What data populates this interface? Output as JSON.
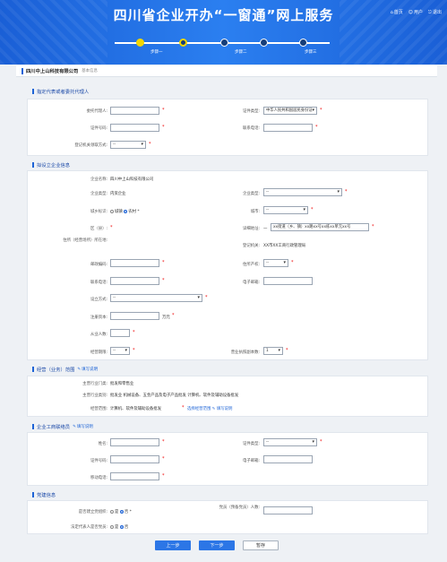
{
  "header": {
    "title": "四川省企业开办“一窗通”网上服务",
    "nav": [
      "首页",
      "用户",
      "退出"
    ],
    "steps": [
      "步骤一",
      "步骤二",
      "步骤三"
    ]
  },
  "crumb": {
    "company": "四川中上山科技有限公司",
    "sub": "基本信息"
  },
  "sections": {
    "s1": "指定代表或者委托代理人",
    "s2": "拟设立企业信息",
    "s3": "经营（业务）范围",
    "s3link": "填写说明",
    "s4": "企业工商联络员",
    "s4link": "填写说明",
    "s5": "党建信息"
  },
  "s1": {
    "l1": "委托代理人:",
    "l2": "证件类型:",
    "v2": "中华人民共和国居民身份证",
    "l3": "证件号码:",
    "l4": "联系电话:",
    "l5": "登记机关领取方式:",
    "v5": "--"
  },
  "s2": {
    "name_l": "企业名称:",
    "name_v": "四川中上山科技有限公司",
    "type_l": "企业类型:",
    "type_v": "内资企业",
    "ind_l": "企业类型:",
    "ind_v": "--",
    "area_l": "城乡标识:",
    "area_o1": "城镇",
    "area_o2": "农村",
    "city_l": "城市:",
    "city_v": "--",
    "dist_l": "区（县）:",
    "addr_l": "详细地址:",
    "addr_pre": "一",
    "addr_v": "xx街道（乡、镇）xx路xx号xx栋xx单元xx号",
    "place_l": "住所（经营场所）所在地:",
    "reg_l": "登记机关:",
    "reg_v": "XX市XX工商行政管理局",
    "zip_l": "邮政编码:",
    "prop_l": "住所产权:",
    "prop_v": "--",
    "tel_l": "联系电话:",
    "mail_l": "电子邮箱:",
    "way_l": "设立方式:",
    "way_v": "--",
    "cap_l": "注册资本:",
    "cap_u": "万元",
    "emp_l": "从业人数:",
    "period_l": "经营期限:",
    "period_v": "--",
    "copies_l": "营业执照副本数:",
    "copies_v": "1"
  },
  "s3": {
    "main_l": "主营行业门类:",
    "main_v": "批发和零售业",
    "ind_l": "主营行业类别:",
    "ind_v": "批发业  机械设备、五金产品及电子产品批发  计算机、软件及辅助设备批发",
    "scope_l": "经营范围:",
    "scope_v": "计算机、软件及辅助设备批发",
    "link1": "选择经营范围",
    "link2": "填写说明"
  },
  "s4": {
    "name_l": "姓名:",
    "idtype_l": "证件类型:",
    "idtype_v": "--",
    "idno_l": "证件号码:",
    "mail_l": "电子邮箱:",
    "mobile_l": "移动电话:"
  },
  "s5": {
    "q1": "是否建立党组织:",
    "q2": "法定代表人是否党员:",
    "yes": "是",
    "no": "否",
    "count_l": "党员（预备党员）人数:"
  },
  "buttons": {
    "prev": "上一步",
    "next": "下一步",
    "save": "暂存"
  }
}
